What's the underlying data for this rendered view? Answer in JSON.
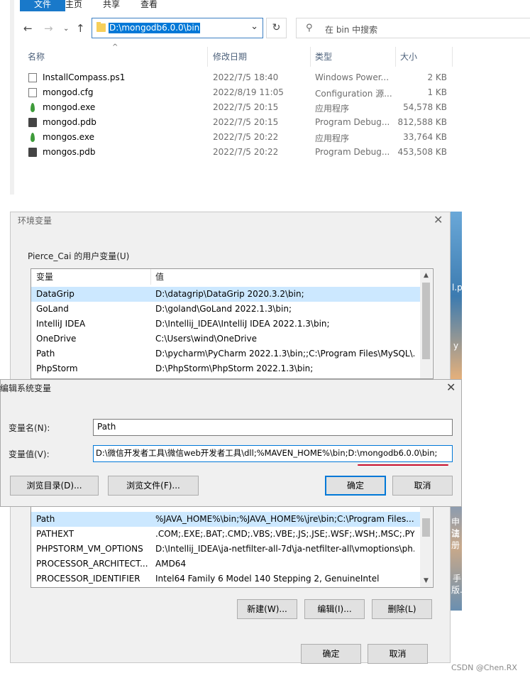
{
  "explorer": {
    "ribbon_tabs": [
      "文件",
      "主页",
      "共享",
      "查看"
    ],
    "address": "D:\\mongodb6.0.0\\bin",
    "search_placeholder": "在 bin 中搜索",
    "columns": {
      "name": "名称",
      "date": "修改日期",
      "type": "类型",
      "size": "大小"
    },
    "files": [
      {
        "name": "InstallCompass.ps1",
        "date": "2022/7/5 18:40",
        "type": "Windows Power...",
        "size": "2 KB",
        "icon": "script-file-icon"
      },
      {
        "name": "mongod.cfg",
        "date": "2022/8/19 11:05",
        "type": "Configuration 源...",
        "size": "1 KB",
        "icon": "config-file-icon"
      },
      {
        "name": "mongod.exe",
        "date": "2022/7/5 20:15",
        "type": "应用程序",
        "size": "54,578 KB",
        "icon": "mongodb-leaf-icon"
      },
      {
        "name": "mongod.pdb",
        "date": "2022/7/5 20:15",
        "type": "Program Debug...",
        "size": "812,588 KB",
        "icon": "debug-file-icon"
      },
      {
        "name": "mongos.exe",
        "date": "2022/7/5 20:22",
        "type": "应用程序",
        "size": "33,764 KB",
        "icon": "mongodb-leaf-icon"
      },
      {
        "name": "mongos.pdb",
        "date": "2022/7/5 20:22",
        "type": "Program Debug...",
        "size": "453,508 KB",
        "icon": "debug-file-icon"
      }
    ]
  },
  "env_window": {
    "title": "环境变量",
    "user_group_label": "Pierce_Cai 的用户变量(U)",
    "col_var": "变量",
    "col_value": "值",
    "user_vars": [
      {
        "name": "DataGrip",
        "value": "D:\\datagrip\\DataGrip 2020.3.2\\bin;"
      },
      {
        "name": "GoLand",
        "value": "D:\\goland\\GoLand 2022.1.3\\bin;"
      },
      {
        "name": "IntelliJ IDEA",
        "value": "D:\\Intellij_IDEA\\IntelliJ IDEA 2022.1.3\\bin;"
      },
      {
        "name": "OneDrive",
        "value": "C:\\Users\\wind\\OneDrive"
      },
      {
        "name": "Path",
        "value": "D:\\pycharm\\PyCharm 2022.1.3\\bin;;C:\\Program Files\\MySQL\\..."
      },
      {
        "name": "PhpStorm",
        "value": "D:\\PhpStorm\\PhpStorm 2022.1.3\\bin;"
      }
    ],
    "system_vars": [
      {
        "name": "Path",
        "value": "%JAVA_HOME%\\bin;%JAVA_HOME%\\jre\\bin;C:\\Program Files..."
      },
      {
        "name": "PATHEXT",
        "value": ".COM;.EXE;.BAT;.CMD;.VBS;.VBE;.JS;.JSE;.WSF;.WSH;.MSC;.PY;.P..."
      },
      {
        "name": "PHPSTORM_VM_OPTIONS",
        "value": "D:\\Intellij_IDEA\\ja-netfilter-all-7d\\ja-netfilter-all\\vmoptions\\ph..."
      },
      {
        "name": "PROCESSOR_ARCHITECT...",
        "value": "AMD64"
      },
      {
        "name": "PROCESSOR_IDENTIFIER",
        "value": "Intel64 Family 6 Model 140 Stepping 2, GenuineIntel"
      }
    ],
    "new_button": "新建(W)...",
    "edit_button": "编辑(I)...",
    "delete_button": "删除(L)",
    "ok_button": "确定",
    "cancel_button": "取消",
    "desktop_chars": [
      "l.py",
      "y",
      "申请",
      "注册",
      "手",
      "版..."
    ]
  },
  "edit_dialog": {
    "title": "编辑系统变量",
    "name_label": "变量名(N):",
    "name_value": "Path",
    "value_label": "变量值(V):",
    "value_value": "D:\\微信开发者工具\\微信web开发者工具\\dll;%MAVEN_HOME%\\bin;D:\\mongodb6.0.0\\bin;",
    "browse_dir_button": "浏览目录(D)...",
    "browse_file_button": "浏览文件(F)...",
    "ok_button": "确定",
    "cancel_button": "取消"
  },
  "watermark": "CSDN @Chen.RX"
}
